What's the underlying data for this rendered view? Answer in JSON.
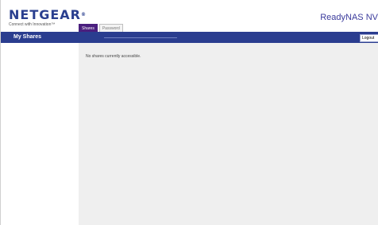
{
  "brand": {
    "logo": "NETGEAR",
    "logo_mark": "®",
    "tagline": "Connect with Innovation™"
  },
  "product": {
    "name": "ReadyNAS NV"
  },
  "tabs": [
    {
      "label": "Shares",
      "active": true
    },
    {
      "label": "Password",
      "active": false
    }
  ],
  "navbar": {
    "section_title": "My Shares",
    "logout_label": "Logout"
  },
  "content": {
    "message": "No shares currently accessible."
  },
  "colors": {
    "navbar": "#2a3d8f",
    "active_tab": "#4a1f7e",
    "content_bg": "#efefef"
  }
}
